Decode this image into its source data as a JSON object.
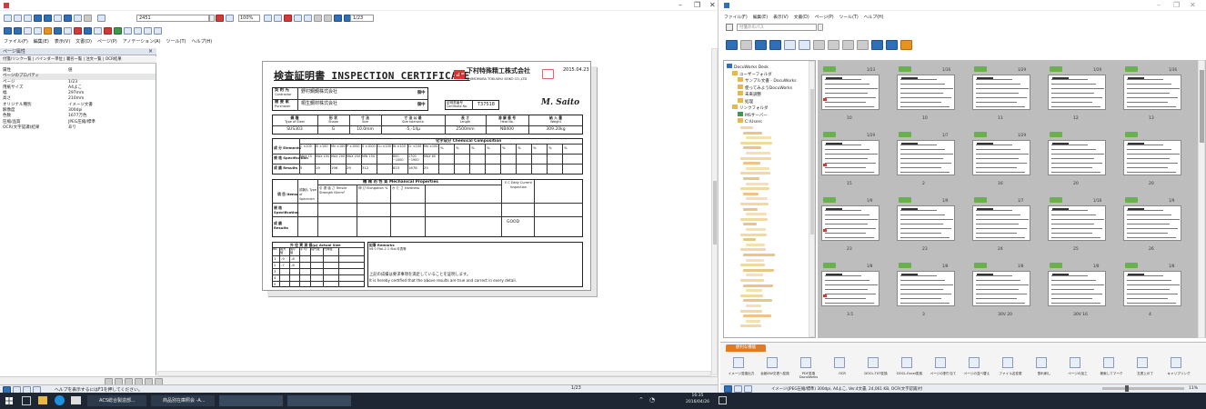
{
  "left_window": {
    "title": "",
    "page_input": "2451",
    "zoom": "100%",
    "page_counter": "1/23",
    "menu": [
      "ファイル(F)",
      "編集(E)",
      "表示(V)",
      "文書(D)",
      "ページ(P)",
      "アノテーション(A)",
      "ツール(T)",
      "ヘルプ(H)"
    ],
    "panel_title": "ページ属性",
    "panel_tabs": "付箋/リンク一覧 | バインダー単位 | 署名一覧 | 注文一覧 | OCR結果",
    "properties": [
      {
        "k": "属性",
        "v": "値"
      },
      {
        "k": "ページのプロパティ",
        "v": ""
      },
      {
        "k": "ページ",
        "v": "1/23"
      },
      {
        "k": "用紙サイズ",
        "v": "A4よこ"
      },
      {
        "k": "幅",
        "v": "297mm"
      },
      {
        "k": "高さ",
        "v": "210mm"
      },
      {
        "k": "オリジナル種別",
        "v": "イメージ文書"
      },
      {
        "k": "解像度",
        "v": "300dpi"
      },
      {
        "k": "色数",
        "v": "1677万色"
      },
      {
        "k": "圧縮/品質",
        "v": "JPEG圧縮/標準"
      },
      {
        "k": "OCR(文字認識)結果",
        "v": "あり"
      }
    ],
    "status_text": "ヘルプを表示するにはF1を押してください。",
    "status_page": "1/23"
  },
  "certificate": {
    "title": "検査証明書 INSPECTION CERTIFICATE",
    "company": "下村特殊精工株式会社",
    "company_en": "SHIMOMURA TOKUSHU SEIKO CO.,LTD",
    "date": "2015.04.23",
    "contractor_label": "契 約 先",
    "contractor_label_en": "Contractor",
    "contractor": "野村鋼鋼株式会社",
    "purchaser_label": "需 要 家",
    "purchaser_label_en": "Purchaser",
    "purchaser": "桐生鋼材株式会社",
    "onchu": "御中",
    "cert_no_label": "証明書番号",
    "cert_no_label_en": "Certificate No.",
    "cert_no": "T37518",
    "signature": "M. Saito",
    "headers": [
      {
        "jp": "鋼 種",
        "en": "Type of Steel",
        "val": "SUS303"
      },
      {
        "jp": "形 状",
        "en": "Shape",
        "val": "G"
      },
      {
        "jp": "寸 法",
        "en": "Size",
        "val": "10.0mm"
      },
      {
        "jp": "寸 法 公 差",
        "en": "Size tolerance",
        "val": "-5,-14μ"
      },
      {
        "jp": "長 さ",
        "en": "Length",
        "val": "2500mm"
      },
      {
        "jp": "溶 解 番 号",
        "en": "Heat No.",
        "val": "NB400"
      },
      {
        "jp": "納 入 量",
        "en": "Weight",
        "val": "309.20kg"
      }
    ],
    "chem_title": "化学成分 Chemical Composition",
    "chem_rows": [
      "成 分 Elements",
      "規 格 Specification",
      "成 績 Results"
    ],
    "chem_elements": [
      "C ×100",
      "Si ×100",
      "Mn ×100",
      "P ×1000",
      "S ×1000",
      "Cu ×100",
      "Ni ×100",
      "Cr ×100",
      "Mo ×100"
    ],
    "chem_spec": [
      "MAX 15",
      "MAX 100",
      "MAX 200",
      "MAX 200",
      "MIN 150",
      "",
      "800 ~1000",
      "1700 ~1900",
      "MAX 60"
    ],
    "chem_results": [
      "5",
      "19",
      "196",
      "29",
      "312",
      "",
      "823",
      "1678",
      "25"
    ],
    "mech_title": "機 械 的 性 質 Mechanical Properties",
    "mech_cols": [
      "引 張 強 さ Tensile Strength N/mm²",
      "伸 び Elongation %",
      "か た さ Hardness",
      "E C Eddy Current Inspection"
    ],
    "mech_items": "項 目 Items",
    "mech_specimen": "試験片 Type of Specimen",
    "mech_rows": [
      "規 格 Specification",
      "成 績 Results"
    ],
    "mech_ec": "GOOD",
    "size_title": "外 径 実 測 値(μ) Actual Size",
    "size_head": [
      "No.",
      "最大 値",
      "最小 値",
      "平 均",
      "真円度",
      "円筒度"
    ],
    "size_rows": [
      [
        "1",
        "-9",
        "-6"
      ],
      [
        "2",
        "-7",
        "-8"
      ],
      [
        "3",
        "",
        ""
      ],
      [
        "4",
        "",
        ""
      ],
      [
        "5",
        "",
        ""
      ]
    ],
    "remarks_label": "記事 Remarks",
    "remarks_line": "h6 0 Ftol.2 1 Std.可表等",
    "certify_jp": "上記の成績は要求事項を満足していることを証明します。",
    "certify_en": "It is hereby certified that the above results are true and correct in every detail."
  },
  "right_window": {
    "title": "",
    "menu": [
      "ファイル(F)",
      "編集(E)",
      "表示(V)",
      "文書(D)",
      "ページ(P)",
      "ツール(T)",
      "ヘルプ(H)"
    ],
    "search_placeholder": "付箋外のパス",
    "tree": [
      {
        "label": "DocuWorks Desk",
        "level": 0
      },
      {
        "label": "ユーザーフォルダ",
        "level": 1
      },
      {
        "label": "サンプル文書 - DocuWorks",
        "level": 2
      },
      {
        "label": "使ってみようDocuWorks",
        "level": 2
      },
      {
        "label": "未来調整",
        "level": 2
      },
      {
        "label": "処理",
        "level": 2
      },
      {
        "label": "リンクフォルダ",
        "level": 1
      },
      {
        "label": "MSサーバー",
        "level": 2
      },
      {
        "label": "C:\\Users",
        "level": 2
      }
    ],
    "thumbs": [
      [
        "1/23",
        "1/16",
        "1/29",
        "1/29",
        "1/36"
      ],
      [
        "1/29",
        "1/7",
        "1/29",
        "",
        ""
      ],
      [
        "1/9",
        "1/9",
        "1/7",
        "1/18",
        "1/9"
      ],
      [
        "1/8",
        "1/8",
        "1/8",
        "1/8",
        "1/8"
      ]
    ],
    "thumb_nums": [
      [
        "10",
        "10",
        "11",
        "12",
        "13"
      ],
      [
        "15",
        "2",
        "16",
        "20",
        "20"
      ],
      [
        "23",
        "23",
        "24",
        "25",
        "26"
      ],
      [
        "3.5",
        "3",
        "30V 20",
        "30V 16",
        "4"
      ]
    ],
    "func_tab": "便利な機能",
    "func_items": [
      "イメージ変換出力",
      "台紙DW文書へ変換",
      "PDF変換DocuWorks",
      "OCR",
      "DOCL.TXT変換",
      "DOCL.Excel変換",
      "ページの割り当て",
      "ページの並べ替え",
      "ファイル名変更",
      "割れ刷し",
      "ページの加工",
      "検索してマーク",
      "文書上の丁",
      "キャリブリング"
    ],
    "status_text": "イメージ(JPEG圧縮/標準) 300dpi, A4よこ, Ver.4文書, 24,061 KB, OCR(文字認識)付",
    "zoom": "11%"
  },
  "taskbar": {
    "apps": [
      "ACS総合製造部...",
      "商品別在庫照会 -A...",
      "",
      ""
    ],
    "time": "16:35",
    "date": "2016/04/26"
  }
}
